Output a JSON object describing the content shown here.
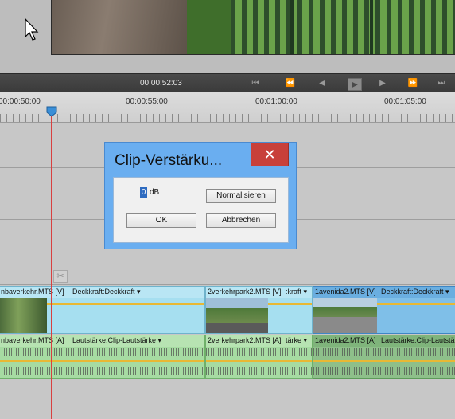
{
  "monitor": {
    "timecode": "00:00:52:03",
    "transport_icons": [
      "go-to-start-icon",
      "step-back-icon",
      "frame-back-icon",
      "play-icon",
      "frame-forward-icon",
      "step-forward-icon",
      "go-to-end-icon"
    ]
  },
  "ruler": {
    "labels": [
      "00:00:50:00",
      "00:00:55:00",
      "00:01:00:00",
      "00:01:05:00"
    ]
  },
  "dialog": {
    "title": "Clip-Verstärku...",
    "close_glyph": "✕",
    "gain_value": "0",
    "gain_unit": "dB",
    "normalize_label": "Normalisieren",
    "ok_label": "OK",
    "cancel_label": "Abbrechen"
  },
  "tracks": {
    "video_clips": [
      {
        "name": "nbaverkehr.MTS [V]",
        "prop": "Deckkraft:Deckkraft ▾"
      },
      {
        "name": "2verkehrpark2.MTS [V]",
        "prop": ":kraft ▾"
      },
      {
        "name": "1avenida2.MTS [V]",
        "prop": "Deckkraft:Deckkraft ▾"
      }
    ],
    "audio_clips": [
      {
        "name": "nbaverkehr.MTS [A]",
        "prop": "Lautstärke:Clip-Lautstärke ▾"
      },
      {
        "name": "2verkehrpark2.MTS [A]",
        "prop": "tärke ▾"
      },
      {
        "name": "1avenida2.MTS [A]",
        "prop": "Lautstärke:Clip-Lautstärke ▾"
      }
    ]
  },
  "colors": {
    "dialog_frame": "#6aaef0",
    "close_button": "#c8403a",
    "video_clip": "#a6dff0",
    "audio_clip": "#a6dba2",
    "playhead": "#d84040"
  }
}
